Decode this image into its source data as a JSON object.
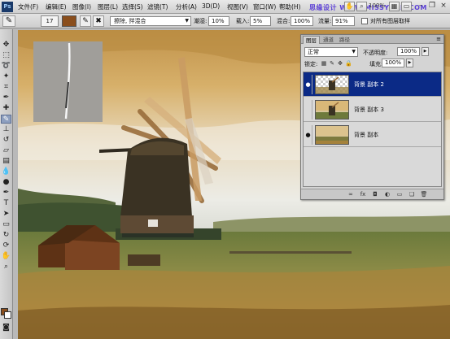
{
  "menubar": {
    "logo": "Ps",
    "items": [
      "文件(F)",
      "编辑(E)",
      "图像(I)",
      "图层(L)",
      "选择(S)",
      "滤镜(T)",
      "分析(A)",
      "3D(D)",
      "视图(V)",
      "窗口(W)",
      "帮助(H)"
    ],
    "zoom": "100%",
    "watermark": "思缘设计 WWW.MISSYUAN.COM"
  },
  "options": {
    "brush_size": "17",
    "mode_label": "模式:",
    "mode_value": "擦除, 拌混合",
    "wet_label": "潮湿:",
    "wet_value": "10%",
    "load_label": "载入:",
    "load_value": "5%",
    "mix_label": "混合:",
    "mix_value": "100%",
    "flow_label": "流量:",
    "flow_value": "91%",
    "sample_all_label": "对所有图层取样",
    "swatch_color": "#8a4e1c"
  },
  "layers_panel": {
    "tabs": [
      "图层",
      "通道",
      "路径"
    ],
    "blend_mode": "正常",
    "opacity_label": "不透明度:",
    "opacity_value": "100%",
    "lock_label": "锁定:",
    "fill_label": "填充:",
    "fill_value": "100%",
    "layers": [
      {
        "name": "背景 副本 2",
        "visible": true,
        "selected": true
      },
      {
        "name": "背景 副本 3",
        "visible": false,
        "selected": false
      },
      {
        "name": "背景 副本",
        "visible": true,
        "selected": false
      }
    ]
  },
  "colors": {
    "selected_layer": "#0b2a86",
    "foreground": "#8a4e1c",
    "background": "#ffffff"
  }
}
